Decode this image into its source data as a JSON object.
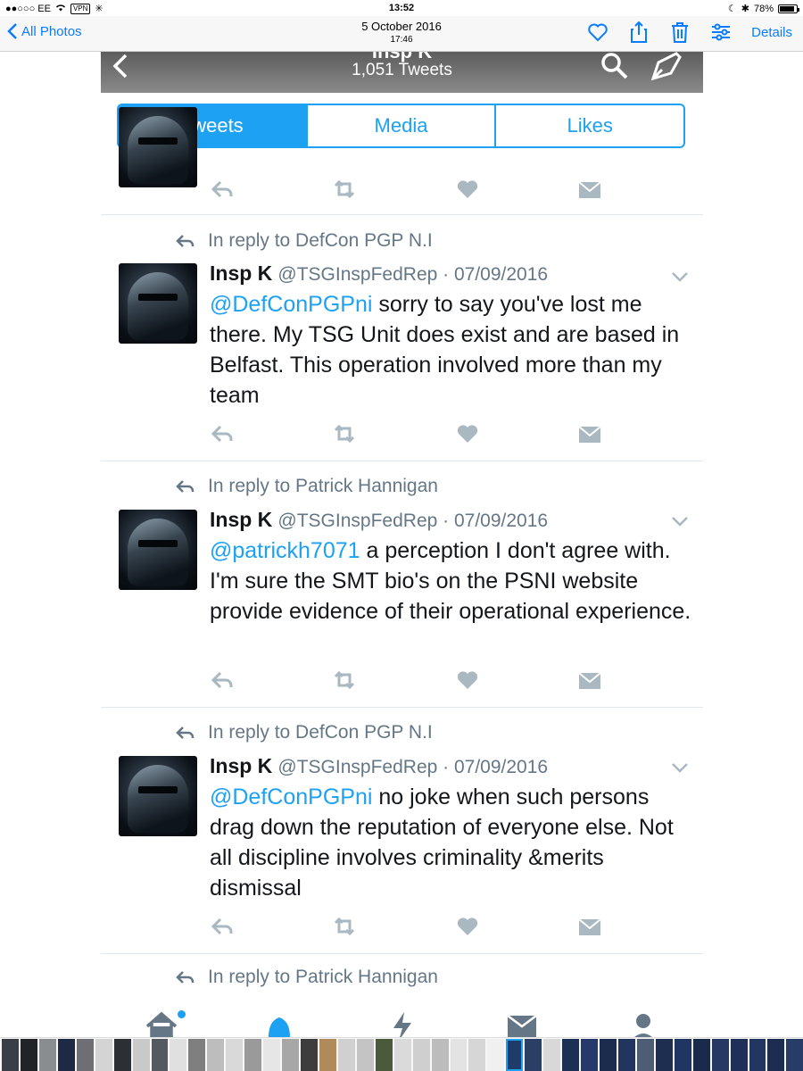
{
  "status_bar": {
    "carrier": "●●○○○ EE",
    "vpn": "VPN",
    "time": "13:52",
    "battery": "78%"
  },
  "photos_bar": {
    "back_label": "All Photos",
    "date": "5 October 2016",
    "time": "17:46",
    "details_label": "Details",
    "icons": [
      "heart-icon",
      "share-icon",
      "trash-icon",
      "sliders-icon"
    ]
  },
  "profile_header": {
    "name": "Insp K",
    "tweet_count": "1,051 Tweets"
  },
  "tabs": [
    {
      "label": "Tweets",
      "active": true
    },
    {
      "label": "Media",
      "active": false
    },
    {
      "label": "Likes",
      "active": false
    }
  ],
  "tweets": [
    {
      "reply_to": "In reply to DefCon PGP N.I",
      "name": "Insp K",
      "handle_date": "@TSGInspFedRep · 07/09/2016",
      "mention": "@DefConPGPni",
      "text": " sorry to say you've lost me there. My TSG Unit does exist and are based in Belfast. This operation involved more than my team"
    },
    {
      "reply_to": "In reply to Patrick Hannigan",
      "name": "Insp K",
      "handle_date": "@TSGInspFedRep · 07/09/2016",
      "mention": "@patrickh7071",
      "text": " a perception I don't agree with. I'm sure the SMT bio's on the PSNI website provide evidence of their operational experience."
    },
    {
      "reply_to": "In reply to DefCon PGP N.I",
      "name": "Insp K",
      "handle_date": "@TSGInspFedRep · 07/09/2016",
      "mention": "@DefConPGPni",
      "text": " no joke when such persons drag down the reputation of everyone else. Not all discipline involves criminality &merits dismissal"
    }
  ],
  "next_reply": "In reply to Patrick Hannigan",
  "bottom_tabs": [
    "home-icon",
    "notifications-icon",
    "moments-icon",
    "messages-icon",
    "profile-icon"
  ],
  "colors": {
    "twitter_blue": "#1da1f2",
    "ios_blue": "#0a7cff",
    "muted_gray": "#657786",
    "action_gray": "#aab8c2"
  }
}
